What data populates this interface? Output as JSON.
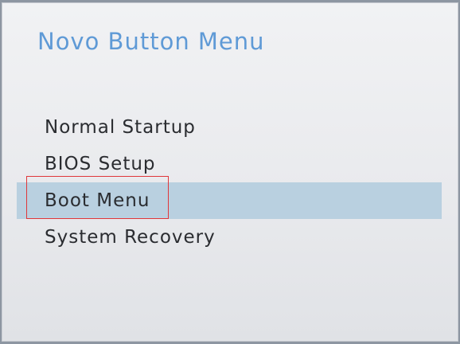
{
  "title": "Novo Button Menu",
  "menu": {
    "items": [
      {
        "label": "Normal Startup",
        "selected": false
      },
      {
        "label": "BIOS Setup",
        "selected": false
      },
      {
        "label": "Boot Menu",
        "selected": true
      },
      {
        "label": "System Recovery",
        "selected": false
      }
    ]
  },
  "colors": {
    "title": "#5f9ad6",
    "selection_bar": "#b9d0e0",
    "annotation_box": "#e0373a",
    "text": "#2a2c30"
  }
}
